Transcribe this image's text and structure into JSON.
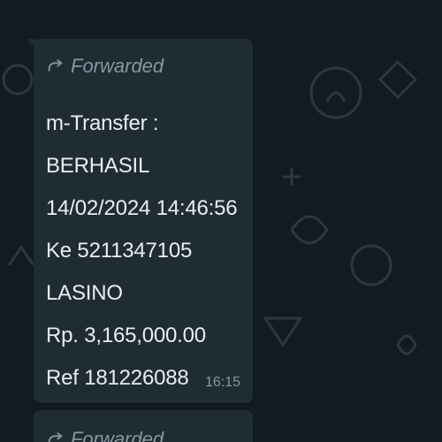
{
  "message": {
    "forwarded_label": "Forwarded",
    "lines": [
      "m-Transfer :",
      "BERHASIL",
      "14/02/2024 14:46:56",
      "Ke 5211347105",
      "LASINO",
      "Rp. 3,165,000.00",
      "Ref 181226088"
    ],
    "time": "16:15"
  },
  "next_message": {
    "forwarded_label": "Forwarded"
  },
  "colors": {
    "background": "#121b22",
    "bubble": "#202c33",
    "text": "#e9edef",
    "muted": "#8696a0"
  },
  "icons": {
    "forward": "forward-arrow-icon"
  }
}
